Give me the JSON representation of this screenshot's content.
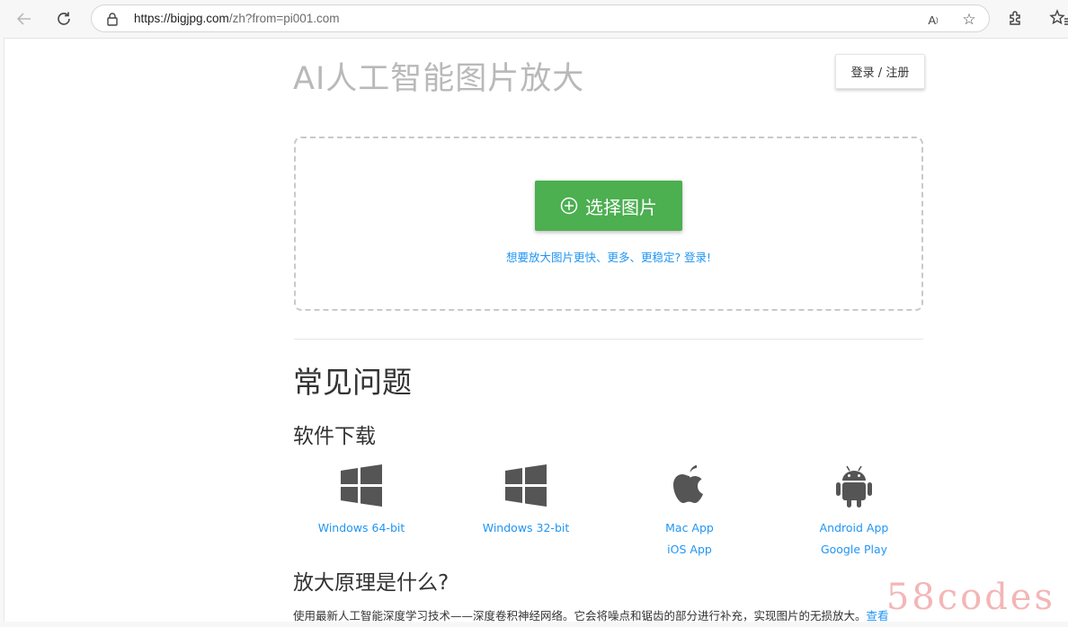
{
  "browser": {
    "url_host": "https://bigjpg.com",
    "url_path": "/zh?from=pi001.com",
    "read_aloud_label": "A",
    "icons": [
      "back-icon",
      "reload-icon",
      "lock-icon",
      "read-aloud-icon",
      "star-icon",
      "extensions-icon",
      "favorites-icon"
    ]
  },
  "header": {
    "title": "AI人工智能图片放大",
    "login_label": "登录 / 注册"
  },
  "upload": {
    "select_label": "选择图片",
    "hint": "想要放大图片更快、更多、更稳定? 登录!"
  },
  "faq": {
    "title": "常见问题",
    "download_title": "软件下载",
    "downloads": [
      {
        "icon": "windows-icon",
        "links": [
          "Windows 64-bit"
        ]
      },
      {
        "icon": "windows-icon",
        "links": [
          "Windows 32-bit"
        ]
      },
      {
        "icon": "apple-icon",
        "links": [
          "Mac App",
          "iOS App"
        ]
      },
      {
        "icon": "android-icon",
        "links": [
          "Android App",
          "Google Play"
        ]
      }
    ],
    "principle_title": "放大原理是什么?",
    "principle_text": "使用最新人工智能深度学习技术——深度卷积神经网络。它会将噪点和锯齿的部分进行补充，实现图片的无损放大。",
    "principle_more": "查看"
  },
  "watermark": "58codes",
  "colors": {
    "accent_green": "#4caf50",
    "link_blue": "#2196f3",
    "title_gray": "#b9b9b9"
  }
}
